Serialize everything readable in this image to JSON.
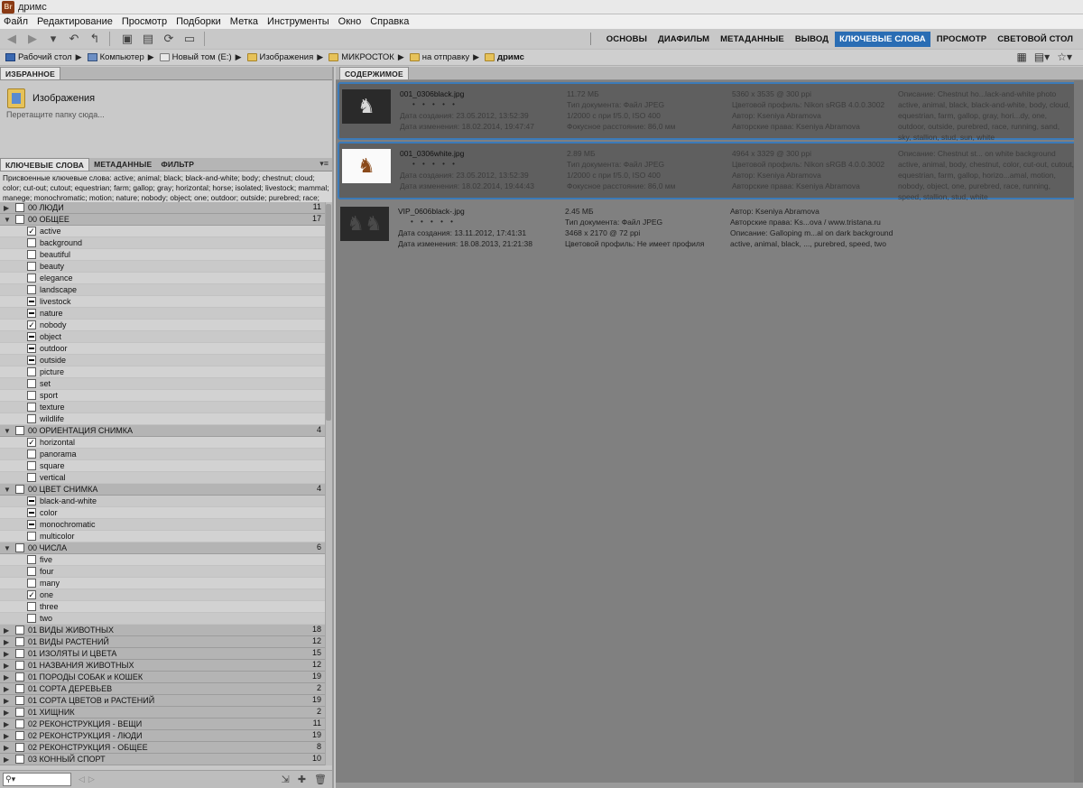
{
  "window": {
    "title": "дримс",
    "app_logo": "Br"
  },
  "menu": [
    "Файл",
    "Редактирование",
    "Просмотр",
    "Подборки",
    "Метка",
    "Инструменты",
    "Окно",
    "Справка"
  ],
  "workspaces": {
    "items": [
      "ОСНОВЫ",
      "ДИАФИЛЬМ",
      "МЕТАДАННЫЕ",
      "ВЫВОД",
      "КЛЮЧЕВЫЕ СЛОВА",
      "ПРОСМОТР",
      "СВЕТОВОЙ СТОЛ"
    ],
    "active": "КЛЮЧЕВЫЕ СЛОВА",
    "accent": "#2a6db4"
  },
  "path": {
    "crumbs": [
      "Рабочий стол",
      "Компьютер",
      "Новый том (E:)",
      "Изображения",
      "МИКРОСТОК",
      "на отправку",
      "дримс"
    ]
  },
  "favorites": {
    "tab": "ИЗБРАННОЕ",
    "folder": "Изображения",
    "hint": "Перетащите папку сюда..."
  },
  "keywords_panel": {
    "tabs": [
      "КЛЮЧЕВЫЕ СЛОВА",
      "МЕТАДАННЫЕ",
      "ФИЛЬТР"
    ],
    "assigned": "Присвоенные ключевые слова: active; animal; black; black-and-white; body; chestnut; cloud; color; cut-out; cutout; equestrian; farm; gallop; gray; horizontal; horse; isolated; livestock; mammal; manege; monochromatic; motion; nature; nobody; object; one; outdoor; outside; purebred; race; running",
    "rows": [
      {
        "type": "group",
        "label": "00 ЛЮДИ",
        "count": "11",
        "expanded": false,
        "state": "none"
      },
      {
        "type": "group",
        "label": "00 ОБЩЕЕ",
        "count": "17",
        "expanded": true,
        "state": "none"
      },
      {
        "type": "item",
        "label": "active",
        "state": "check"
      },
      {
        "type": "item",
        "label": "background",
        "state": "none"
      },
      {
        "type": "item",
        "label": "beautiful",
        "state": "none"
      },
      {
        "type": "item",
        "label": "beauty",
        "state": "none"
      },
      {
        "type": "item",
        "label": "elegance",
        "state": "none"
      },
      {
        "type": "item",
        "label": "landscape",
        "state": "none"
      },
      {
        "type": "item",
        "label": "livestock",
        "state": "dash"
      },
      {
        "type": "item",
        "label": "nature",
        "state": "dash"
      },
      {
        "type": "item",
        "label": "nobody",
        "state": "check"
      },
      {
        "type": "item",
        "label": "object",
        "state": "dash"
      },
      {
        "type": "item",
        "label": "outdoor",
        "state": "dash"
      },
      {
        "type": "item",
        "label": "outside",
        "state": "dash"
      },
      {
        "type": "item",
        "label": "picture",
        "state": "none"
      },
      {
        "type": "item",
        "label": "set",
        "state": "none"
      },
      {
        "type": "item",
        "label": "sport",
        "state": "none"
      },
      {
        "type": "item",
        "label": "texture",
        "state": "none"
      },
      {
        "type": "item",
        "label": "wildlife",
        "state": "none"
      },
      {
        "type": "group",
        "label": "00 ОРИЕНТАЦИЯ СНИМКА",
        "count": "4",
        "expanded": true,
        "state": "none"
      },
      {
        "type": "item",
        "label": "horizontal",
        "state": "check"
      },
      {
        "type": "item",
        "label": "panorama",
        "state": "none"
      },
      {
        "type": "item",
        "label": "square",
        "state": "none"
      },
      {
        "type": "item",
        "label": "vertical",
        "state": "none"
      },
      {
        "type": "group",
        "label": "00 ЦВЕТ СНИМКА",
        "count": "4",
        "expanded": true,
        "state": "none"
      },
      {
        "type": "item",
        "label": "black-and-white",
        "state": "dash"
      },
      {
        "type": "item",
        "label": "color",
        "state": "dash"
      },
      {
        "type": "item",
        "label": "monochromatic",
        "state": "dash"
      },
      {
        "type": "item",
        "label": "multicolor",
        "state": "none"
      },
      {
        "type": "group",
        "label": "00 ЧИСЛА",
        "count": "6",
        "expanded": true,
        "state": "none"
      },
      {
        "type": "item",
        "label": "five",
        "state": "none"
      },
      {
        "type": "item",
        "label": "four",
        "state": "none"
      },
      {
        "type": "item",
        "label": "many",
        "state": "none"
      },
      {
        "type": "item",
        "label": "one",
        "state": "check"
      },
      {
        "type": "item",
        "label": "three",
        "state": "none"
      },
      {
        "type": "item",
        "label": "two",
        "state": "none"
      },
      {
        "type": "group",
        "label": "01 ВИДЫ ЖИВОТНЫХ",
        "count": "18",
        "expanded": false,
        "state": "none"
      },
      {
        "type": "group",
        "label": "01 ВИДЫ РАСТЕНИЙ",
        "count": "12",
        "expanded": false,
        "state": "none"
      },
      {
        "type": "group",
        "label": "01 ИЗОЛЯТЫ И ЦВЕТА",
        "count": "15",
        "expanded": false,
        "state": "none"
      },
      {
        "type": "group",
        "label": "01 НАЗВАНИЯ ЖИВОТНЫХ",
        "count": "12",
        "expanded": false,
        "state": "none"
      },
      {
        "type": "group",
        "label": "01 ПОРОДЫ СОБАК и КОШЕК",
        "count": "19",
        "expanded": false,
        "state": "none"
      },
      {
        "type": "group",
        "label": "01 СОРТА ДЕРЕВЬЕВ",
        "count": "2",
        "expanded": false,
        "state": "none"
      },
      {
        "type": "group",
        "label": "01 СОРТА ЦВЕТОВ и РАСТЕНИЙ",
        "count": "19",
        "expanded": false,
        "state": "none"
      },
      {
        "type": "group",
        "label": "01 ХИЩНИК",
        "count": "2",
        "expanded": false,
        "state": "none"
      },
      {
        "type": "group",
        "label": "02 РЕКОНСТРУКЦИЯ - ВЕЩИ",
        "count": "11",
        "expanded": false,
        "state": "none"
      },
      {
        "type": "group",
        "label": "02 РЕКОНСТРУКЦИЯ - ЛЮДИ",
        "count": "19",
        "expanded": false,
        "state": "none"
      },
      {
        "type": "group",
        "label": "02 РЕКОНСТРУКЦИЯ - ОБЩЕЕ",
        "count": "8",
        "expanded": false,
        "state": "none"
      },
      {
        "type": "group",
        "label": "03 КОННЫЙ СПОРТ",
        "count": "10",
        "expanded": false,
        "state": "none"
      }
    ],
    "search_icon": "search-icon"
  },
  "content": {
    "tab": "СОДЕРЖИМОЕ",
    "files": [
      {
        "name": "001_0306black.jpg",
        "stars": "• • • • •",
        "created": "Дата создания: 23.05.2012, 13:52:39",
        "modified": "Дата изменения: 18.02.2014, 19:47:47",
        "size": "11.72 МБ",
        "type": "Тип документа: Файл JPEG",
        "exposure": "1/2000 с при f/5.0, ISO 400",
        "focal": "Фокусное расстояние: 86,0 мм",
        "dims": "5360 x 3535 @ 300 ppi",
        "profile": "Цветовой профиль: Nikon sRGB 4.0.0.3002",
        "author": "Автор: Kseniya Abramova",
        "rights": "Авторские права: Kseniya Abramova",
        "desc": "Описание: Chestnut ho...lack-and-white photo",
        "keywords": "active, animal, black, black-and-white, body, cloud, equestrian, farm, gallop, gray, hori...dy, one, outdoor, outside, purebred, race, running, sand, sky, stallion, stud, sun, white",
        "selected": true,
        "thumb": "dark-horse"
      },
      {
        "name": "001_0306white.jpg",
        "stars": "• • • • •",
        "created": "Дата создания: 23.05.2012, 13:52:39",
        "modified": "Дата изменения: 18.02.2014, 19:44:43",
        "size": "2.89 МБ",
        "type": "Тип документа: Файл JPEG",
        "exposure": "1/2000 с при f/5.0, ISO 400",
        "focal": "Фокусное расстояние: 86,0 мм",
        "dims": "4964 x 3329 @ 300 ppi",
        "profile": "Цветовой профиль: Nikon sRGB 4.0.0.3002",
        "author": "Автор: Kseniya Abramova",
        "rights": "Авторские права: Kseniya Abramova",
        "desc": "Описание: Chestnut st... on white background",
        "keywords": "active, animal, body, chestnut, color, cut-out, cutout, equestrian, farm, gallop, horizo...amal, motion, nobody, object, one, purebred, race, running, speed, stallion, stud, white",
        "selected": true,
        "thumb": "white-horse"
      },
      {
        "name": "VIP_0606black-.jpg",
        "stars": "• • • • •",
        "created": "Дата создания: 13.11.2012, 17:41:31",
        "modified": "Дата изменения: 18.08.2013, 21:21:38",
        "size": "2.45 МБ",
        "type": "Тип документа: Файл JPEG",
        "dims": "3468 x 2170 @ 72 ppi",
        "profile": "Цветовой профиль: Не имеет профиля",
        "author": "Автор: Kseniya Abramova",
        "rights": "Авторские права: Ks...ova  / www.tristana.ru",
        "desc": "Описание: Galloping m...al on dark background",
        "keywords": "active, animal, black, ..., purebred, speed, two",
        "selected": false,
        "thumb": "dark-horses"
      }
    ]
  }
}
